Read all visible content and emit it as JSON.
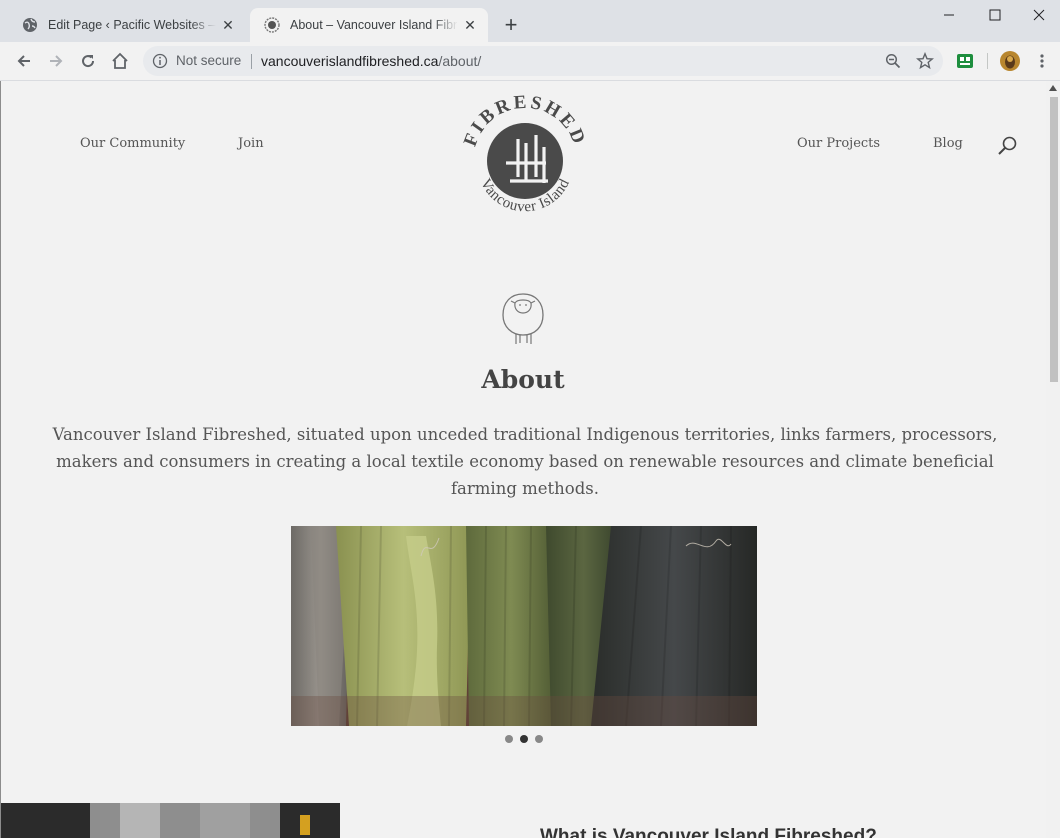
{
  "browser": {
    "tabs": [
      {
        "title": "Edit Page ‹ Pacific Websites — WordPress",
        "active": false
      },
      {
        "title": "About – Vancouver Island Fibreshed",
        "active": true
      }
    ],
    "security_label": "Not secure",
    "url_host": "vancouverislandfibreshed.ca",
    "url_path": "/about/"
  },
  "site": {
    "nav_left": [
      "Our Community",
      "Join"
    ],
    "nav_right": [
      "Our Projects",
      "Blog"
    ],
    "logo_top_text": "FIBRESHED",
    "logo_bottom_text": "Vancouver Island",
    "heading": "About",
    "intro": "Vancouver Island Fibreshed, situated upon unceded traditional Indigenous territories,  links farmers, processors, makers and consumers in creating a local textile economy based on renewable resources and climate beneficial farming methods.",
    "slider_dots": 3,
    "slider_active_index": 1,
    "next_section_heading": "What is Vancouver Island Fibreshed?"
  },
  "colors": {
    "page_bg": "#f2f2f2",
    "logo": "#4a4a4a",
    "text": "#555555"
  }
}
